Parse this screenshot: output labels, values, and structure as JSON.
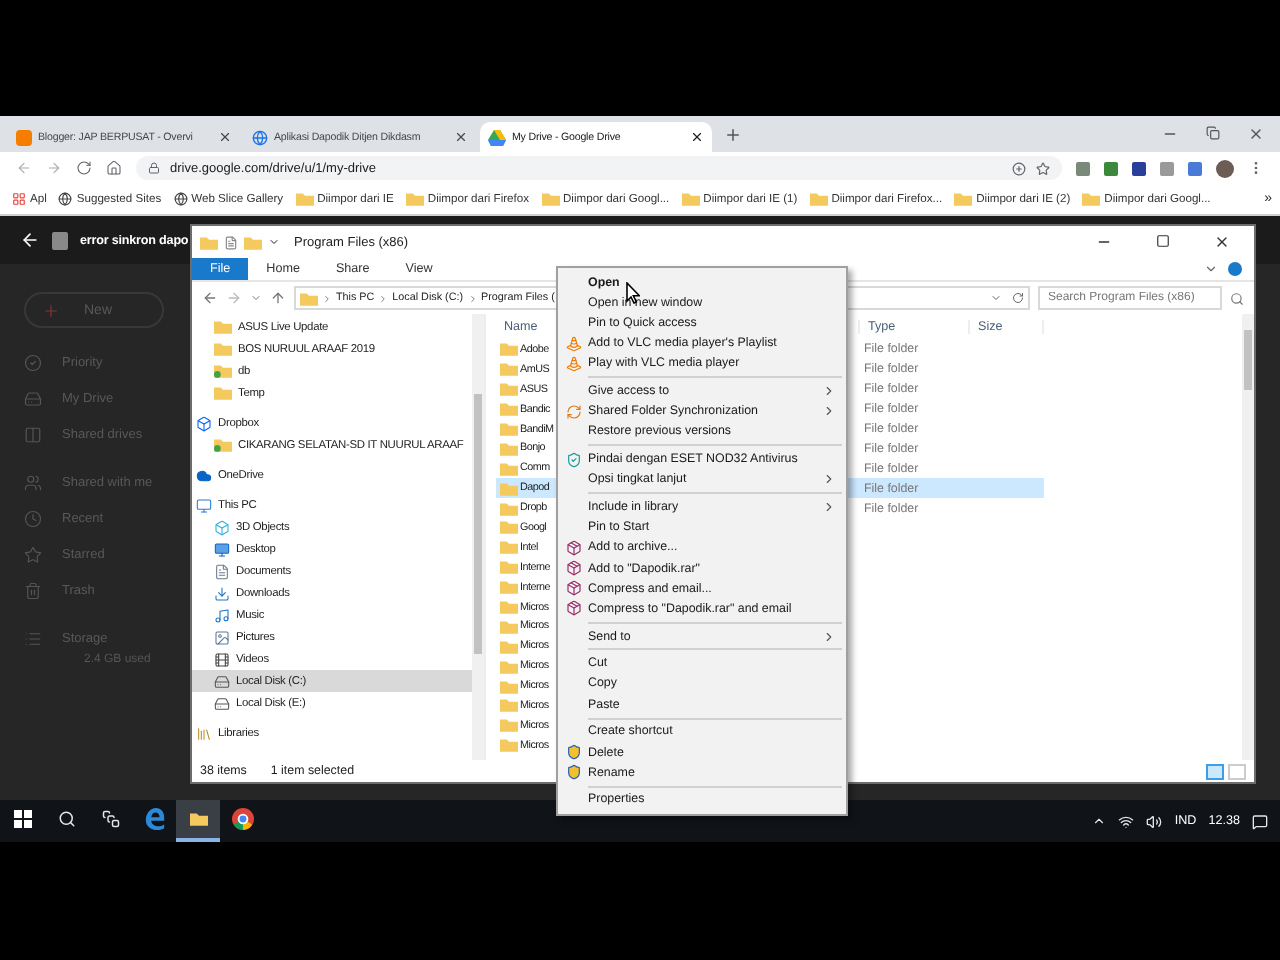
{
  "browser": {
    "tabs": [
      {
        "title": "Blogger: JAP BERPUSAT - Overvi",
        "kind": "blogger",
        "selected": false
      },
      {
        "title": "Aplikasi Dapodik Ditjen Dikdasm",
        "kind": "globe",
        "selected": false
      },
      {
        "title": "My Drive - Google Drive",
        "kind": "drive",
        "selected": true
      }
    ],
    "url": "drive.google.com/drive/u/1/my-drive",
    "bookmarks": [
      {
        "label": "Apl",
        "kind": "apps"
      },
      {
        "label": "Suggested Sites",
        "kind": "globe"
      },
      {
        "label": "Web Slice Gallery",
        "kind": "globe"
      },
      {
        "label": "Diimpor dari IE",
        "kind": "folder"
      },
      {
        "label": "Diimpor dari Firefox",
        "kind": "folder"
      },
      {
        "label": "Diimpor dari Googl...",
        "kind": "folder"
      },
      {
        "label": "Diimpor dari IE (1)",
        "kind": "folder"
      },
      {
        "label": "Diimpor dari Firefox...",
        "kind": "folder"
      },
      {
        "label": "Diimpor dari IE (2)",
        "kind": "folder"
      },
      {
        "label": "Diimpor dari Googl...",
        "kind": "folder"
      }
    ],
    "bookmarks_more": "»"
  },
  "drive": {
    "file_title": "error sinkron dapo",
    "sidebar": [
      {
        "label": "New",
        "kind": "new"
      },
      {
        "label": "Priority",
        "kind": "check"
      },
      {
        "label": "My Drive",
        "kind": "drive"
      },
      {
        "label": "Shared drives",
        "kind": "shared"
      },
      {
        "label": "Shared with me",
        "kind": "people"
      },
      {
        "label": "Recent",
        "kind": "clock"
      },
      {
        "label": "Starred",
        "kind": "star"
      },
      {
        "label": "Trash",
        "kind": "trash"
      },
      {
        "label": "Storage",
        "kind": "storage"
      }
    ],
    "storage_used": "2.4 GB used"
  },
  "explorer": {
    "title": "Program Files (x86)",
    "ribbon_tabs": [
      {
        "label": "File",
        "kind": "file"
      },
      {
        "label": "Home",
        "kind": "tab"
      },
      {
        "label": "Share",
        "kind": "tab"
      },
      {
        "label": "View",
        "kind": "tab"
      }
    ],
    "breadcrumb": [
      "This PC",
      "Local Disk (C:)",
      "Program Files ("
    ],
    "search": {
      "placeholder": "Search Program Files (x86)"
    },
    "nav_pane": {
      "scrolled_items": [
        {
          "label": "ASUS Live Update",
          "kind": "folder",
          "selected": false
        },
        {
          "label": "BOS NURUUL ARAAF 2019",
          "kind": "folder",
          "selected": false
        },
        {
          "label": "db",
          "kind": "folder_sync",
          "selected": false
        },
        {
          "label": "Temp",
          "kind": "folder",
          "selected": false
        }
      ],
      "items": [
        {
          "label": "Dropbox",
          "kind": "dropbox",
          "selected": false,
          "children": [
            {
              "label": "CIKARANG SELATAN-SD IT NUURUL ARAAF",
              "kind": "folder_sync",
              "selected": false
            }
          ]
        },
        {
          "label": "OneDrive",
          "kind": "cloud",
          "selected": false
        },
        {
          "label": "This PC",
          "kind": "pc",
          "selected": false,
          "children": [
            {
              "label": "3D Objects",
              "kind": "cube",
              "selected": false
            },
            {
              "label": "Desktop",
              "kind": "desktop",
              "selected": false
            },
            {
              "label": "Documents",
              "kind": "document",
              "selected": false
            },
            {
              "label": "Downloads",
              "kind": "download",
              "selected": false
            },
            {
              "label": "Music",
              "kind": "music",
              "selected": false
            },
            {
              "label": "Pictures",
              "kind": "picture",
              "selected": false
            },
            {
              "label": "Videos",
              "kind": "video",
              "selected": false
            },
            {
              "label": "Local Disk (C:)",
              "kind": "disk",
              "selected": true
            },
            {
              "label": "Local Disk (E:)",
              "kind": "disk",
              "selected": false
            }
          ]
        },
        {
          "label": "Libraries",
          "kind": "library",
          "selected": false
        }
      ]
    },
    "file_list": {
      "columns": [
        "Name",
        "Type",
        "Size"
      ],
      "rows": [
        {
          "name": "Adobe",
          "type": "File folder",
          "selected": false
        },
        {
          "name": "AmUS",
          "type": "File folder",
          "selected": false
        },
        {
          "name": "ASUS",
          "type": "File folder",
          "selected": false
        },
        {
          "name": "Bandic",
          "type": "File folder",
          "selected": false
        },
        {
          "name": "BandiM",
          "type": "File folder",
          "selected": false
        },
        {
          "name": "Bonjo",
          "type": "File folder",
          "selected": false
        },
        {
          "name": "Comm",
          "type": "File folder",
          "selected": false
        },
        {
          "name": "Dapod",
          "type": "File folder",
          "selected": true
        },
        {
          "name": "Dropb",
          "type": "File folder",
          "selected": false
        },
        {
          "name": "Googl",
          "selected": false
        },
        {
          "name": "Intel",
          "selected": false
        },
        {
          "name": "Interne",
          "selected": false
        },
        {
          "name": "Interne",
          "selected": false
        },
        {
          "name": "Micros",
          "selected": false
        },
        {
          "name": "Micros",
          "selected": false
        },
        {
          "name": "Micros",
          "selected": false
        },
        {
          "name": "Micros",
          "selected": false
        },
        {
          "name": "Micros",
          "selected": false
        },
        {
          "name": "Micros",
          "selected": false
        },
        {
          "name": "Micros",
          "selected": false
        },
        {
          "name": "Micros",
          "selected": false
        }
      ]
    },
    "status": {
      "count": "38 items",
      "selection": "1 item selected"
    }
  },
  "context_menu": [
    {
      "kind": "default",
      "label": "Open",
      "submenu": false
    },
    {
      "kind": "item",
      "label": "Open in new window",
      "submenu": false
    },
    {
      "kind": "item",
      "label": "Pin to Quick access",
      "submenu": false
    },
    {
      "kind": "vlc",
      "label": "Add to VLC media player's Playlist",
      "submenu": false
    },
    {
      "kind": "vlc",
      "label": "Play with VLC media player",
      "submenu": false
    },
    {
      "kind": "separator"
    },
    {
      "kind": "item",
      "label": "Give access to",
      "submenu": true
    },
    {
      "kind": "sync",
      "label": "Shared Folder Synchronization",
      "submenu": true
    },
    {
      "kind": "item",
      "label": "Restore previous versions",
      "submenu": false
    },
    {
      "kind": "separator"
    },
    {
      "kind": "antivirus",
      "label": "Pindai dengan ESET NOD32 Antivirus",
      "submenu": false
    },
    {
      "kind": "item",
      "label": "Opsi tingkat lanjut",
      "submenu": true
    },
    {
      "kind": "separator"
    },
    {
      "kind": "item",
      "label": "Include in library",
      "submenu": true
    },
    {
      "kind": "item",
      "label": "Pin to Start",
      "submenu": false
    },
    {
      "kind": "archive",
      "label": "Add to archive...",
      "submenu": false
    },
    {
      "kind": "archive",
      "label": "Add to \"Dapodik.rar\"",
      "submenu": false
    },
    {
      "kind": "archive",
      "label": "Compress and email...",
      "submenu": false
    },
    {
      "kind": "archive",
      "label": "Compress to \"Dapodik.rar\" and email",
      "submenu": false
    },
    {
      "kind": "separator"
    },
    {
      "kind": "item",
      "label": "Send to",
      "submenu": true
    },
    {
      "kind": "separator"
    },
    {
      "kind": "item",
      "label": "Cut",
      "submenu": false
    },
    {
      "kind": "item",
      "label": "Copy",
      "submenu": false
    },
    {
      "kind": "item",
      "label": "Paste",
      "submenu": false
    },
    {
      "kind": "separator"
    },
    {
      "kind": "item",
      "label": "Create shortcut",
      "submenu": false
    },
    {
      "kind": "shield",
      "label": "Delete",
      "submenu": false
    },
    {
      "kind": "shield",
      "label": "Rename",
      "submenu": false
    },
    {
      "kind": "separator"
    },
    {
      "kind": "item",
      "label": "Properties",
      "submenu": false
    }
  ],
  "taskbar": {
    "apps": [
      {
        "kind": "edge",
        "active": false
      },
      {
        "kind": "explorer",
        "active": true
      },
      {
        "kind": "chrome",
        "active": false
      }
    ],
    "language": "IND",
    "time": "12.38"
  }
}
